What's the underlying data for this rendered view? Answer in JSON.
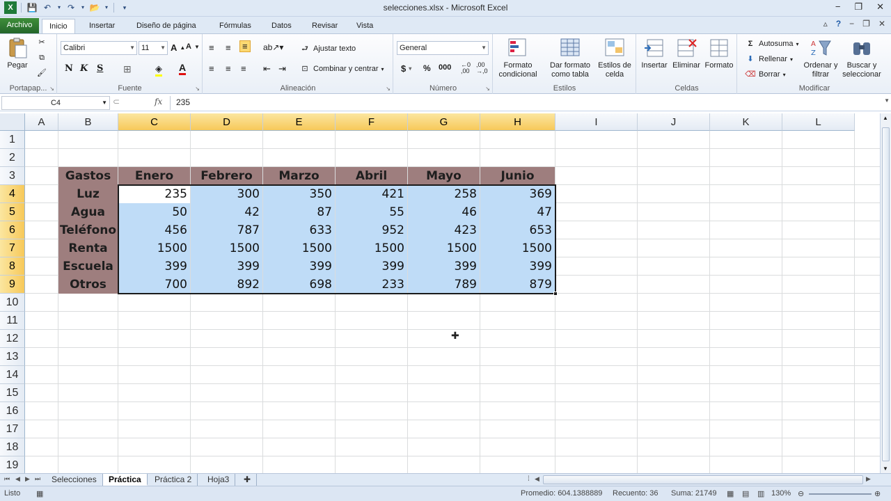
{
  "window": {
    "title": "selecciones.xlsx - Microsoft Excel",
    "controls": [
      "−",
      "❐",
      "✕"
    ]
  },
  "tabs": [
    "Archivo",
    "Inicio",
    "Insertar",
    "Diseño de página",
    "Fórmulas",
    "Datos",
    "Revisar",
    "Vista"
  ],
  "active_tab": "Inicio",
  "ribbon": {
    "portapapeles": {
      "paste": "Pegar",
      "title": "Portapap..."
    },
    "fuente": {
      "font": "Calibri",
      "size": "11",
      "title": "Fuente"
    },
    "alineacion": {
      "wrap": "Ajustar texto",
      "merge": "Combinar y centrar",
      "title": "Alineación"
    },
    "numero": {
      "format": "General",
      "title": "Número"
    },
    "estilos": {
      "cond": "Formato condicional",
      "table": "Dar formato como tabla",
      "cell": "Estilos de celda",
      "title": "Estilos"
    },
    "celdas": {
      "insert": "Insertar",
      "delete": "Eliminar",
      "format": "Formato",
      "title": "Celdas"
    },
    "modificar": {
      "autosum": "Autosuma",
      "fill": "Rellenar",
      "clear": "Borrar",
      "sort": "Ordenar y filtrar",
      "find": "Buscar y seleccionar",
      "title": "Modificar"
    }
  },
  "formula_bar": {
    "name_box": "C4",
    "fx": "fx",
    "value": "235"
  },
  "columns": [
    "A",
    "B",
    "C",
    "D",
    "E",
    "F",
    "G",
    "H",
    "I",
    "J",
    "K",
    "L"
  ],
  "rows": [
    "1",
    "2",
    "3",
    "4",
    "5",
    "6",
    "7",
    "8",
    "9",
    "10",
    "11",
    "12",
    "13",
    "14",
    "15",
    "16",
    "17",
    "18",
    "19"
  ],
  "table": {
    "header": [
      "Gastos",
      "Enero",
      "Febrero",
      "Marzo",
      "Abril",
      "Mayo",
      "Junio"
    ],
    "rows": [
      {
        "label": "Luz",
        "values": [
          "235",
          "300",
          "350",
          "421",
          "258",
          "369"
        ]
      },
      {
        "label": "Agua",
        "values": [
          "50",
          "42",
          "87",
          "55",
          "46",
          "47"
        ]
      },
      {
        "label": "Teléfono",
        "values": [
          "456",
          "787",
          "633",
          "952",
          "423",
          "653"
        ]
      },
      {
        "label": "Renta",
        "values": [
          "1500",
          "1500",
          "1500",
          "1500",
          "1500",
          "1500"
        ]
      },
      {
        "label": "Escuela",
        "values": [
          "399",
          "399",
          "399",
          "399",
          "399",
          "399"
        ]
      },
      {
        "label": "Otros",
        "values": [
          "700",
          "892",
          "698",
          "233",
          "789",
          "879"
        ]
      }
    ]
  },
  "sheets": [
    "Selecciones",
    "Práctica",
    "Práctica 2",
    "Hoja3"
  ],
  "active_sheet": "Práctica",
  "status": {
    "ready": "Listo",
    "average": "Promedio: 604.1388889",
    "count": "Recuento: 36",
    "sum": "Suma: 21749",
    "zoom": "130%"
  },
  "colors": {
    "header_fill": "#9e7e7e",
    "selection_fill": "#bfdcf7",
    "file_tab": "#2a6b2c"
  }
}
